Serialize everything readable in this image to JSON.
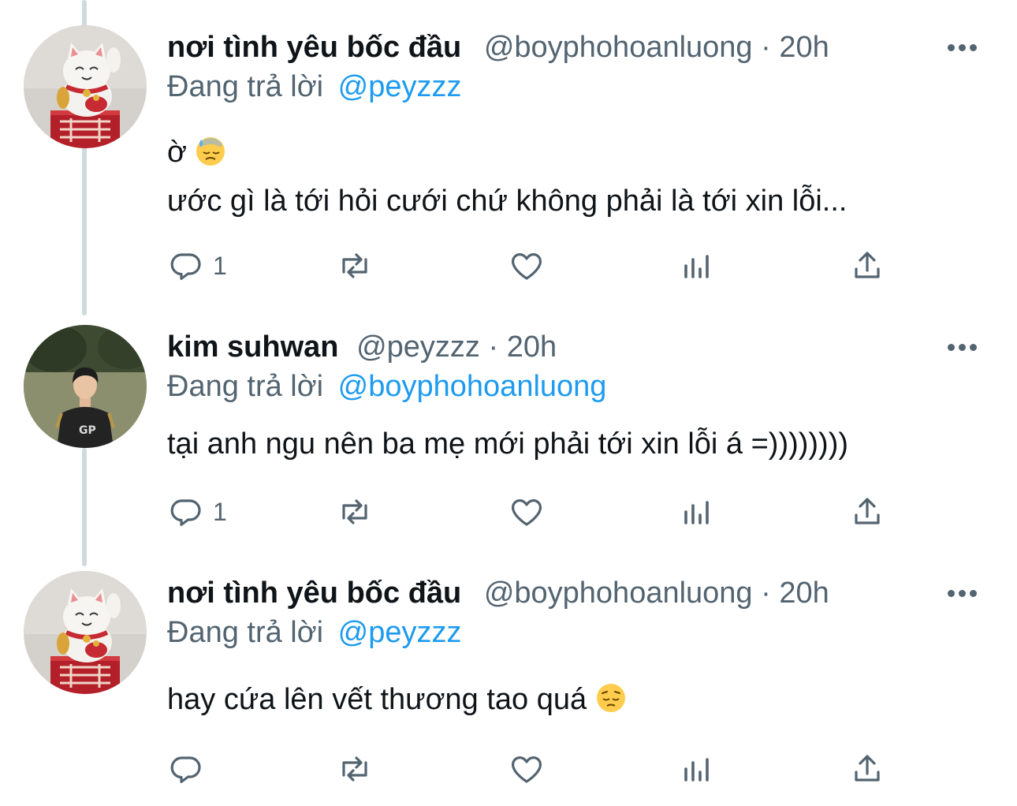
{
  "tweets": [
    {
      "display_name": "nơi tình yêu bốc đầu",
      "handle": "@boyphohoanluong",
      "separator": "·",
      "time": "20h",
      "reply_prefix": "Đang trả lời",
      "reply_to": "@peyzzz",
      "text_lines": [
        "ờ",
        "ước gì là tới hỏi cưới chứ không phải là tới xin lỗi..."
      ],
      "emoji": "downcast-face-with-sweat",
      "reply_count": "1"
    },
    {
      "display_name": "kim suhwan",
      "handle": "@peyzzz",
      "separator": "·",
      "time": "20h",
      "reply_prefix": "Đang trả lời",
      "reply_to": "@boyphohoanluong",
      "text_lines": [
        "tại anh ngu nên ba mẹ mới phải tới xin lỗi á =))))))))"
      ],
      "reply_count": "1"
    },
    {
      "display_name": "nơi tình yêu bốc đầu",
      "handle": "@boyphohoanluong",
      "separator": "·",
      "time": "20h",
      "reply_prefix": "Đang trả lời",
      "reply_to": "@peyzzz",
      "text_lines": [
        "hay cứa lên vết thương tao quá"
      ],
      "emoji": "pensive-face",
      "reply_count": ""
    }
  ],
  "colors": {
    "text_primary": "#0f1419",
    "text_secondary": "#536471",
    "link": "#1d9bf0",
    "thread_line": "#cfd9de"
  },
  "icons": {
    "reply": "reply-icon",
    "retweet": "retweet-icon",
    "like": "heart-icon",
    "analytics": "analytics-icon",
    "share": "share-icon",
    "more": "more-icon"
  }
}
